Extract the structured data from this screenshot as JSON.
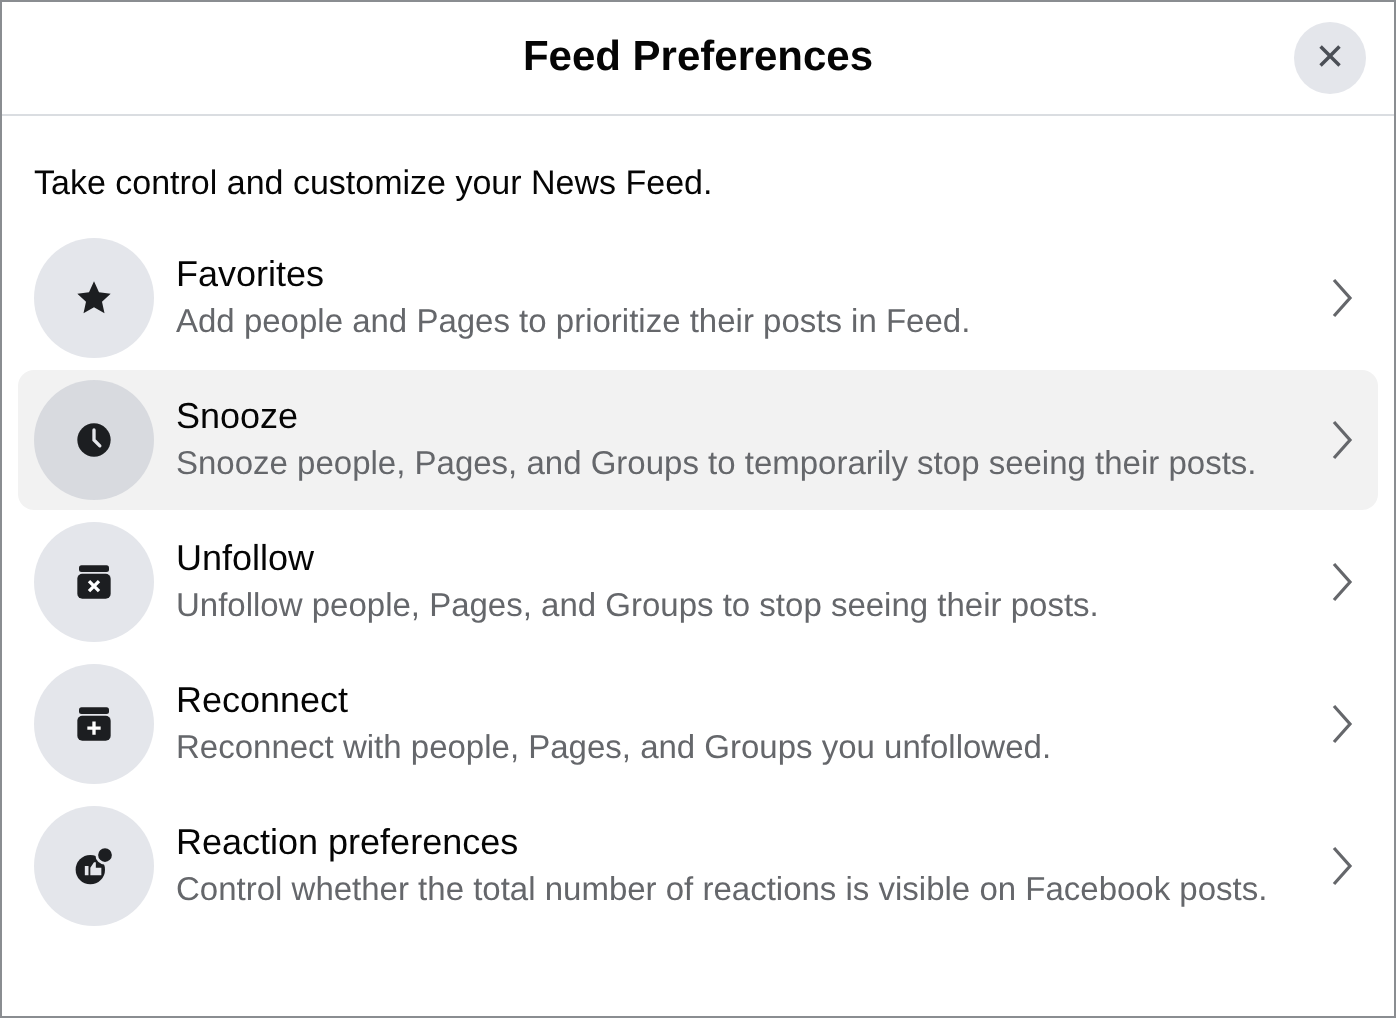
{
  "dialog": {
    "title": "Feed Preferences",
    "close": "×"
  },
  "intro": "Take control and customize your News Feed.",
  "items": [
    {
      "kind": "star",
      "title": "Favorites",
      "description": "Add people and Pages to prioritize their posts in Feed.",
      "selected": false
    },
    {
      "kind": "clock",
      "title": "Snooze",
      "description": "Snooze people, Pages, and Groups to temporarily stop seeing their posts.",
      "selected": true
    },
    {
      "kind": "box-x",
      "title": "Unfollow",
      "description": "Unfollow people, Pages, and Groups to stop seeing their posts.",
      "selected": false
    },
    {
      "kind": "box-plus",
      "title": "Reconnect",
      "description": "Reconnect with people, Pages, and Groups you unfollowed.",
      "selected": false
    },
    {
      "kind": "reaction",
      "title": "Reaction preferences",
      "description": "Control whether the total number of reactions is visible on Facebook posts.",
      "selected": false
    }
  ]
}
